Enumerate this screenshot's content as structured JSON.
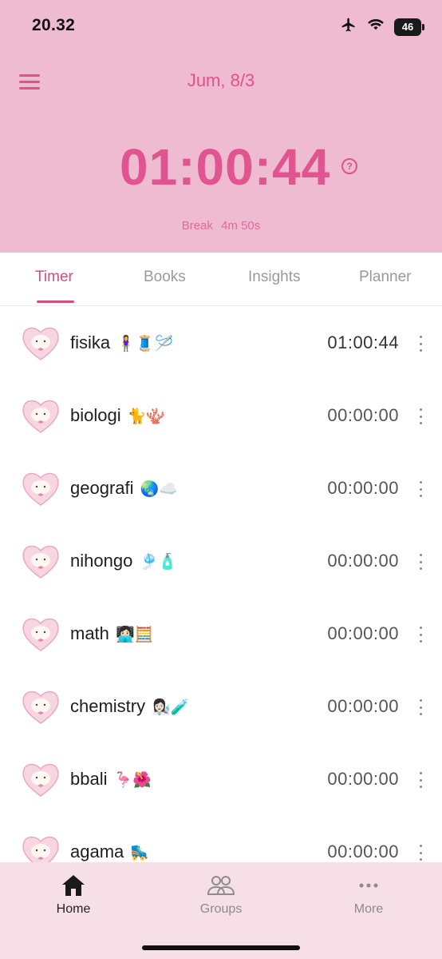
{
  "status_bar": {
    "time": "20.32",
    "battery": "46",
    "icons": [
      "airplane-icon",
      "wifi-icon",
      "battery-icon"
    ]
  },
  "header": {
    "date": "Jum, 8/3",
    "timer": "01:00:44",
    "break_label": "Break",
    "break_value": "4m 50s",
    "background_color": "#eebbd0",
    "accent_color": "#e0528a"
  },
  "tabs": [
    {
      "label": "Timer",
      "active": true
    },
    {
      "label": "Books",
      "active": false
    },
    {
      "label": "Insights",
      "active": false
    },
    {
      "label": "Planner",
      "active": false
    }
  ],
  "subjects": [
    {
      "name": "fisika",
      "emoji": "🧍‍♀️🧵🪡",
      "time": "01:00:44"
    },
    {
      "name": "biologi",
      "emoji": "🐈🪸",
      "time": "00:00:00"
    },
    {
      "name": "geografi",
      "emoji": "🌏☁️",
      "time": "00:00:00"
    },
    {
      "name": "nihongo",
      "emoji": "🎐🧴",
      "time": "00:00:00"
    },
    {
      "name": "math",
      "emoji": "👩🏻‍💻🧮",
      "time": "00:00:00"
    },
    {
      "name": "chemistry",
      "emoji": "👩🏻‍🔬🧪",
      "time": "00:00:00"
    },
    {
      "name": "bbali",
      "emoji": "🦩🌺",
      "time": "00:00:00"
    },
    {
      "name": "agama",
      "emoji": "🛼",
      "time": "00:00:00"
    }
  ],
  "bottom_nav": [
    {
      "label": "Home",
      "icon": "home-icon",
      "active": true
    },
    {
      "label": "Groups",
      "icon": "groups-icon",
      "active": false
    },
    {
      "label": "More",
      "icon": "more-icon",
      "active": false
    }
  ]
}
